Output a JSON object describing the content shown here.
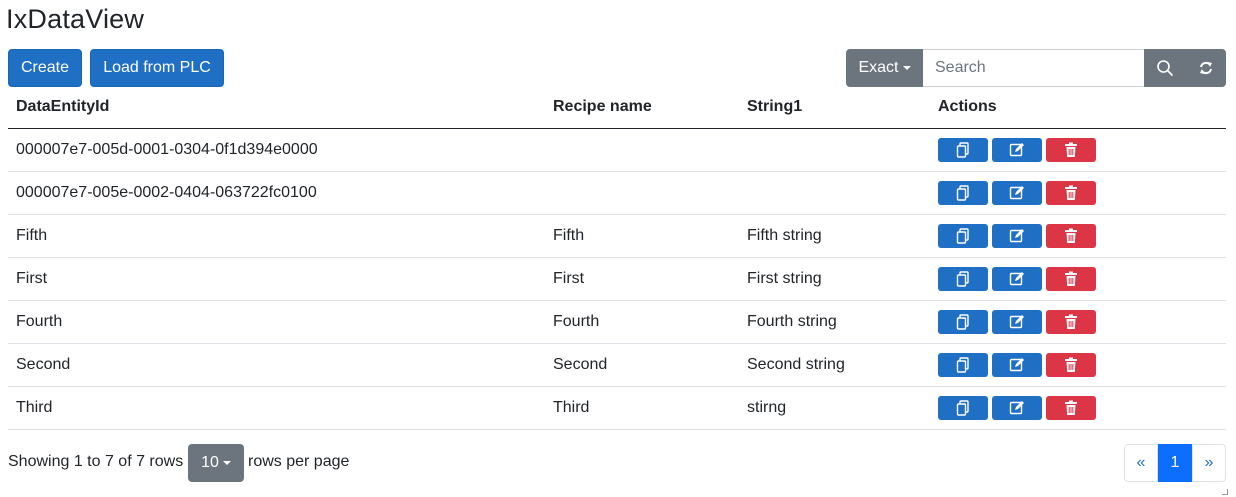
{
  "title": "IxDataView",
  "toolbar": {
    "create_label": "Create",
    "load_label": "Load from PLC",
    "match_mode": "Exact",
    "search_placeholder": "Search",
    "search_value": ""
  },
  "table": {
    "headers": [
      "DataEntityId",
      "Recipe name",
      "String1",
      "Actions"
    ],
    "rows": [
      [
        "000007e7-005d-0001-0304-0f1d394e0000",
        "",
        ""
      ],
      [
        "000007e7-005e-0002-0404-063722fc0100",
        "",
        ""
      ],
      [
        "Fifth",
        "Fifth",
        "Fifth string"
      ],
      [
        "First",
        "First",
        "First string"
      ],
      [
        "Fourth",
        "Fourth",
        "Fourth string"
      ],
      [
        "Second",
        "Second",
        "Second string"
      ],
      [
        "Third",
        "Third",
        "stirng"
      ]
    ],
    "action_icons": [
      "copy-icon",
      "edit-icon",
      "trash-icon"
    ]
  },
  "footer": {
    "showing_text": "Showing 1 to 7 of 7 rows",
    "page_size": "10",
    "rows_per_page_text": "rows per page",
    "pagination": {
      "prev": "«",
      "current": "1",
      "next": "»"
    }
  },
  "colors": {
    "primary": "#1f6fc5",
    "secondary": "#6c757d",
    "danger": "#dc3545",
    "active_page": "#0d6efd"
  }
}
